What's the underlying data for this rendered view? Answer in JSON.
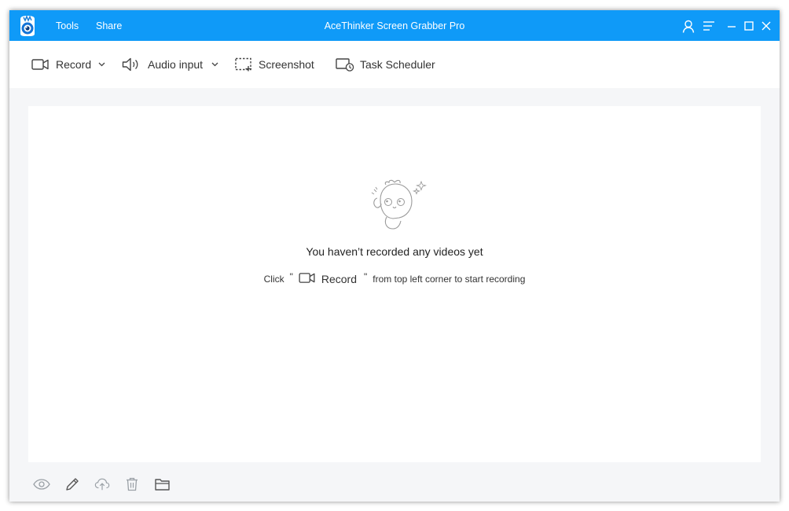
{
  "titlebar": {
    "menu": [
      {
        "label": "Tools"
      },
      {
        "label": "Share"
      }
    ],
    "title": "AceThinker Screen Grabber Pro"
  },
  "toolbar": {
    "record_label": "Record",
    "audio_label": "Audio input",
    "screenshot_label": "Screenshot",
    "scheduler_label": "Task Scheduler"
  },
  "empty_state": {
    "title": "You haven’t recorded any videos yet",
    "hint_prefix": "Click",
    "hint_open_quote": "\"",
    "hint_record": "Record",
    "hint_close_quote": "\"",
    "hint_suffix": "from top left corner to start recording"
  },
  "icons": {
    "app": "app-logo-icon",
    "user": "user-icon",
    "menu": "hamburger-menu-icon",
    "minimize": "minimize-icon",
    "maximize": "maximize-icon",
    "close": "close-icon",
    "footer": [
      "eye-icon",
      "pencil-icon",
      "cloud-upload-icon",
      "trash-icon",
      "folder-icon"
    ]
  },
  "colors": {
    "titlebar": "#0f9af8",
    "window_bg": "#f5f6f8",
    "text": "#333333"
  }
}
